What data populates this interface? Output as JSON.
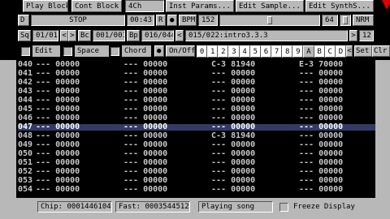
{
  "toolbar_row1": {
    "play_block": "Play Block",
    "cont_block": "Cont Block",
    "channels": "4Ch",
    "inst_params": "Inst Params...",
    "edit_sample": "Edit Sample...",
    "edit_synth": "Edit SynthS..."
  },
  "toolbar_row2": {
    "d_label": "D",
    "status": "STOP",
    "time": "00:43",
    "r_label": "R",
    "bpm_label": "BPM",
    "bpm_value": "152",
    "volume_value": "64",
    "nrm_label": "NRM"
  },
  "toolbar_row3": {
    "sq_label": "Sq",
    "sq_value": "01/01",
    "bc_label": "Bc",
    "bc_value": "001/001",
    "bp_label": "Bp",
    "bp_value": "016/044",
    "block_label": "015/022:intro3.3.3",
    "end_num": "12"
  },
  "toolbar_row4": {
    "edit_label": "Edit",
    "space_label": "Space",
    "chord_label": "Chord",
    "onoff_label": "On/Off",
    "hex_keys": [
      "0",
      "1",
      "2",
      "3",
      "4",
      "5",
      "6",
      "7",
      "8",
      "9",
      "A",
      "B",
      "C",
      "D"
    ],
    "hex_active_index": 10,
    "set_label": "Set",
    "clr_label": "Clr"
  },
  "grid": {
    "current_row_index": 7,
    "rows": [
      {
        "num": "040",
        "t1": "--- 00000",
        "t2": "--- 00000",
        "t3": "C-3 81940",
        "t4": "E-3 70000"
      },
      {
        "num": "041",
        "t1": "--- 00000",
        "t2": "--- 00000",
        "t3": "--- 00000",
        "t4": "--- 00000"
      },
      {
        "num": "042",
        "t1": "--- 00000",
        "t2": "--- 00000",
        "t3": "--- 00000",
        "t4": "--- 00000"
      },
      {
        "num": "043",
        "t1": "--- 00000",
        "t2": "--- 00000",
        "t3": "--- 00000",
        "t4": "--- 00000"
      },
      {
        "num": "044",
        "t1": "--- 00000",
        "t2": "--- 00000",
        "t3": "--- 00000",
        "t4": "--- 00000"
      },
      {
        "num": "045",
        "t1": "--- 00000",
        "t2": "--- 00000",
        "t3": "--- 00000",
        "t4": "--- 00000"
      },
      {
        "num": "046",
        "t1": "--- 00000",
        "t2": "--- 00000",
        "t3": "--- 00000",
        "t4": "--- 00000"
      },
      {
        "num": "047",
        "t1": "--- 00000",
        "t2": "--- 00000",
        "t3": "--- 00000",
        "t4": "--- 00000"
      },
      {
        "num": "048",
        "t1": "--- 00000",
        "t2": "--- 00000",
        "t3": "C-3 81940",
        "t4": "--- 00000"
      },
      {
        "num": "049",
        "t1": "--- 00000",
        "t2": "--- 00000",
        "t3": "--- 00000",
        "t4": "--- 00000"
      },
      {
        "num": "050",
        "t1": "--- 00000",
        "t2": "--- 00000",
        "t3": "--- 00000",
        "t4": "--- 00000"
      },
      {
        "num": "051",
        "t1": "--- 00000",
        "t2": "--- 00000",
        "t3": "--- 00000",
        "t4": "--- 00000"
      },
      {
        "num": "052",
        "t1": "--- 00000",
        "t2": "--- 00000",
        "t3": "--- 00000",
        "t4": "--- 00000"
      },
      {
        "num": "053",
        "t1": "--- 00000",
        "t2": "--- 00000",
        "t3": "--- 00000",
        "t4": "--- 00000"
      },
      {
        "num": "054",
        "t1": "--- 00000",
        "t2": "--- 00000",
        "t3": "--- 00000",
        "t4": "--- 00000"
      }
    ]
  },
  "status_bar": {
    "chip": "Chip: 0001446104",
    "fast": "Fast: 0003544512",
    "playing": "Playing song",
    "freeze": "Freeze Display"
  },
  "colors": {
    "panel": "#b8b8b8",
    "grid_bg": "#000000",
    "cursor_row": "#333a66",
    "pointer": "#dd0000"
  }
}
